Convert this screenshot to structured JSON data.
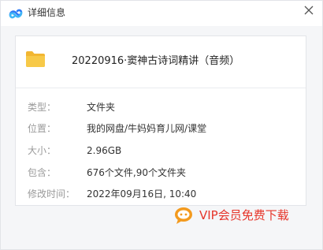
{
  "window": {
    "title": "详细信息"
  },
  "file": {
    "name": "20220916·窦神古诗词精讲（音频）"
  },
  "details": [
    {
      "label": "类型：",
      "value": "文件夹"
    },
    {
      "label": "位置：",
      "value": "我的网盘/牛妈妈育儿网/课堂"
    },
    {
      "label": "大小：",
      "value": "2.96GB"
    },
    {
      "label": "包含：",
      "value": "676个文件,90个文件夹"
    },
    {
      "label": "修改时间：",
      "value": "2022年09月16日, 10:40"
    }
  ],
  "watermark": {
    "text": "VIP会员免费下载"
  },
  "colors": {
    "folder": "#f7c948",
    "logo_blue": "#2e7bf6",
    "watermark_red": "#e6352a"
  }
}
